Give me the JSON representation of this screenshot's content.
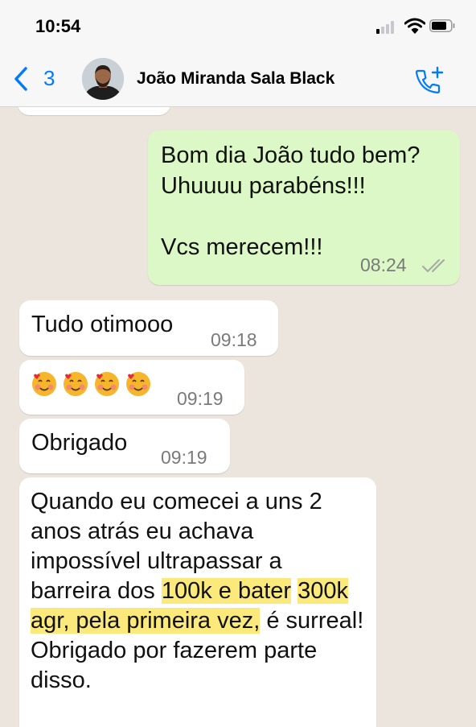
{
  "status_bar": {
    "time": "10:54"
  },
  "header": {
    "back_count": "3",
    "contact_name": "João Miranda Sala Black"
  },
  "messages": [
    {
      "direction": "outgoing",
      "text": "Bom dia João tudo bem?\nUhuuuu parabéns!!!\n\nVcs merecem!!!",
      "time": "08:24",
      "status": "read"
    },
    {
      "direction": "incoming",
      "text": "Tudo otimooo",
      "time": "09:18"
    },
    {
      "direction": "incoming",
      "emoji": [
        "smiling-face-with-hearts",
        "smiling-face-with-hearts",
        "smiling-face-with-hearts",
        "smiling-face-with-hearts"
      ],
      "time": "09:19"
    },
    {
      "direction": "incoming",
      "text": "Obrigado",
      "time": "09:19"
    },
    {
      "direction": "incoming",
      "text_before": "Quando eu comecei a uns 2 anos atrás eu achava impossível ultrapassar a barreira dos ",
      "highlight_1": "100k e bater",
      "highlight_2": "300k agr, pela primeira vez,",
      "text_after": " é surreal! Obrigado por fazerem parte disso."
    }
  ],
  "colors": {
    "outgoing_bubble": "#DCF8C6",
    "incoming_bubble": "#FFFFFF",
    "chat_background": "#ECE5DD",
    "accent": "#007AFF",
    "highlight": "#FCE97C"
  }
}
